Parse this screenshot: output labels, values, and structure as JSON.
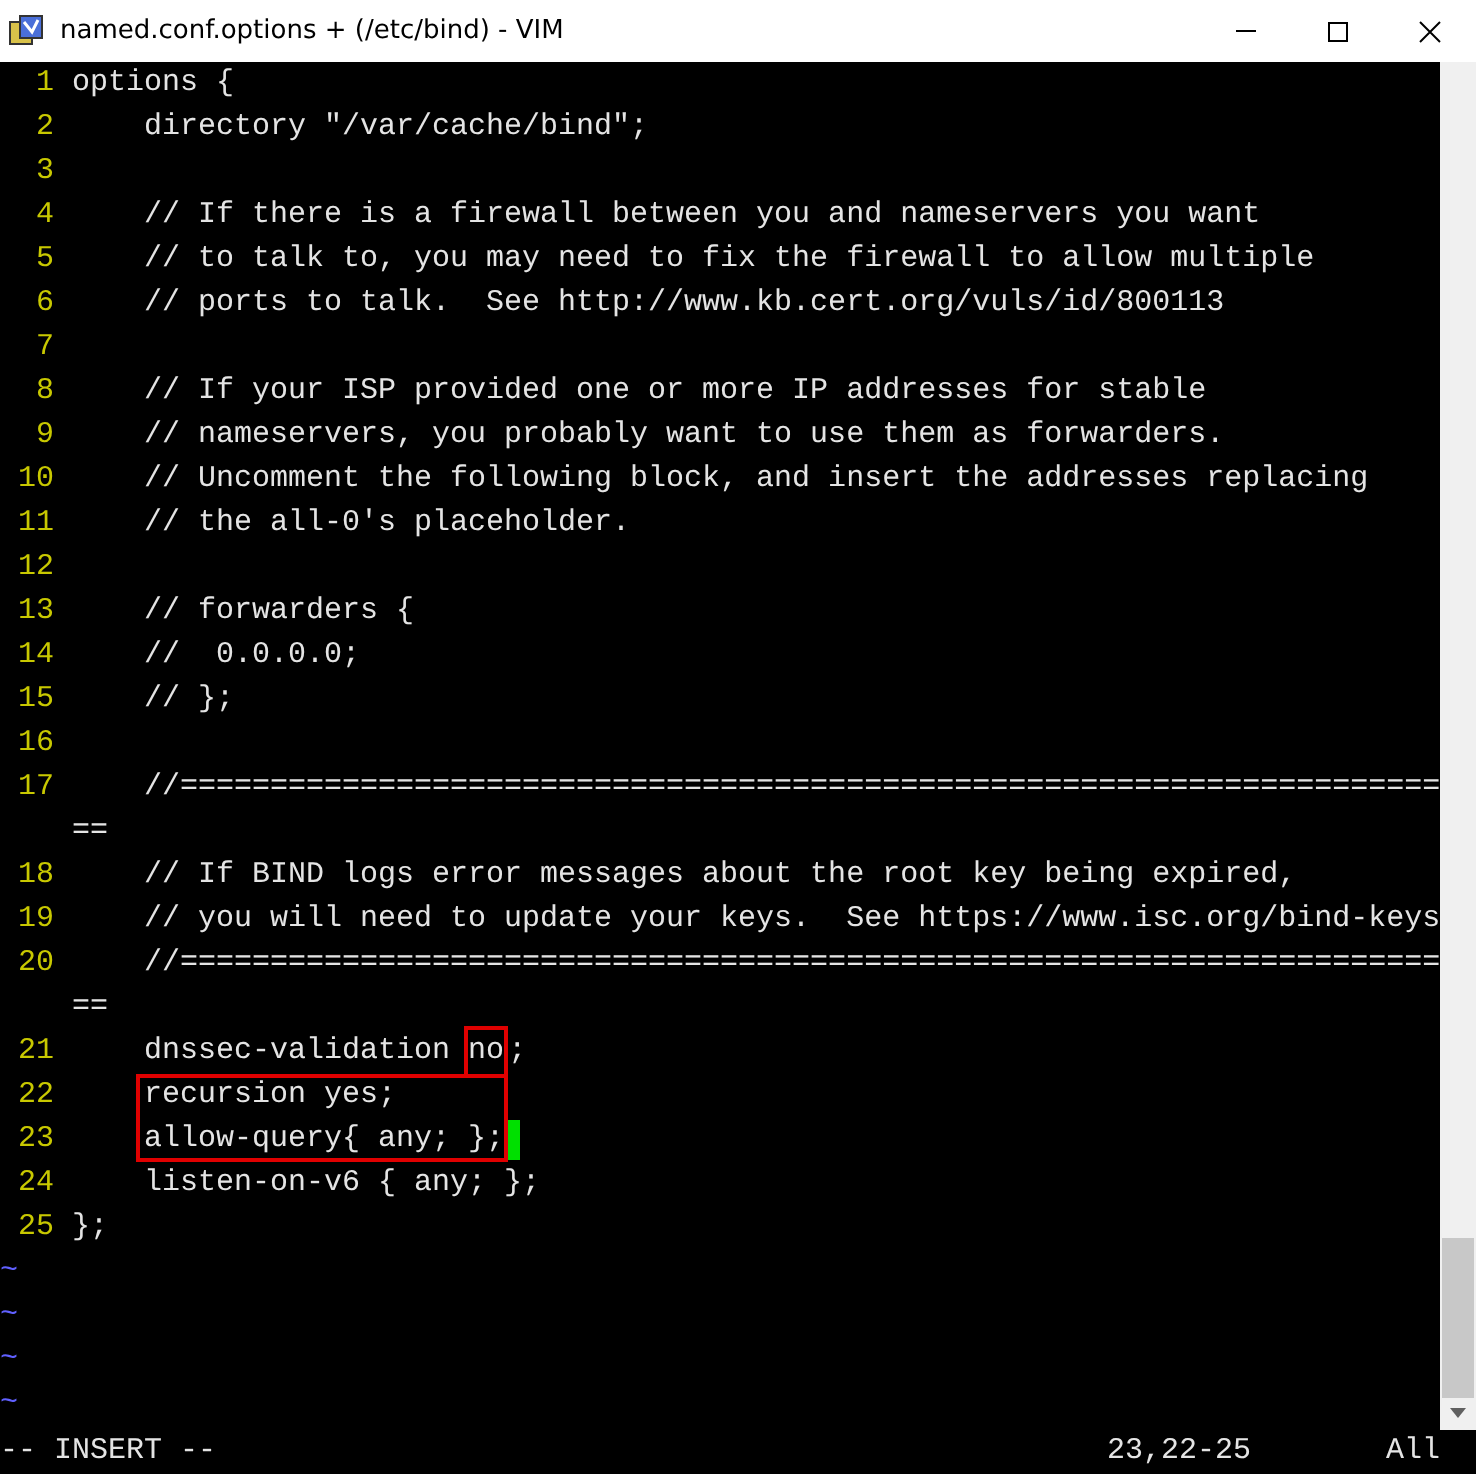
{
  "window": {
    "title": "named.conf.options + (/etc/bind) - VIM"
  },
  "lines": [
    {
      "kind": "line",
      "number": "1",
      "text": "options {"
    },
    {
      "kind": "line",
      "number": "2",
      "text": "    directory \"/var/cache/bind\";"
    },
    {
      "kind": "line",
      "number": "3"
    },
    {
      "kind": "line",
      "number": "4",
      "text": "    // If there is a firewall between you and nameservers you want"
    },
    {
      "kind": "line",
      "number": "5",
      "text": "    // to talk to, you may need to fix the firewall to allow multiple"
    },
    {
      "kind": "line",
      "number": "6",
      "text": "    // ports to talk.  See http://www.kb.cert.org/vuls/id/800113"
    },
    {
      "kind": "line",
      "number": "7"
    },
    {
      "kind": "line",
      "number": "8",
      "text": "    // If your ISP provided one or more IP addresses for stable"
    },
    {
      "kind": "line",
      "number": "9",
      "text": "    // nameservers, you probably want to use them as forwarders."
    },
    {
      "kind": "line",
      "number": "10",
      "text": "    // Uncomment the following block, and insert the addresses replacing"
    },
    {
      "kind": "line",
      "number": "11",
      "text": "    // the all-0's placeholder."
    },
    {
      "kind": "line",
      "number": "12"
    },
    {
      "kind": "line",
      "number": "13",
      "text": "    // forwarders {"
    },
    {
      "kind": "line",
      "number": "14",
      "text": "    //  0.0.0.0;"
    },
    {
      "kind": "line",
      "number": "15",
      "text": "    // };"
    },
    {
      "kind": "line",
      "number": "16"
    },
    {
      "kind": "line",
      "number": "17",
      "text": "    //========================================================================"
    },
    {
      "kind": "line",
      "number": "18",
      "text": "    // If BIND logs error messages about the root key being expired,"
    },
    {
      "kind": "line",
      "number": "19",
      "text": "    // you will need to update your keys.  See https://www.isc.org/bind-keys"
    },
    {
      "kind": "line",
      "number": "20",
      "text": "    //========================================================================"
    },
    {
      "kind": "segments",
      "number": "21",
      "segments": [
        {
          "text": "    dnssec-validation ",
          "boxed": false
        },
        {
          "text": "no",
          "boxed": true
        },
        {
          "text": ";",
          "boxed": false
        }
      ]
    },
    {
      "kind": "boxed_group",
      "children": [
        {
          "kind": "line",
          "number": "22",
          "text": "    recursion yes;"
        },
        {
          "kind": "line",
          "number": "23",
          "text": "    allow-query{ any; };",
          "cursor": true
        }
      ]
    },
    {
      "kind": "line",
      "number": "24",
      "text": "    listen-on-v6 { any; };"
    },
    {
      "kind": "line",
      "number": "25",
      "text": "};"
    }
  ],
  "empty_lines": [
    "~",
    "~",
    "~",
    "~"
  ],
  "status_bar": {
    "mode": "-- INSERT --",
    "position": "23,22-25",
    "scroll": "All"
  }
}
